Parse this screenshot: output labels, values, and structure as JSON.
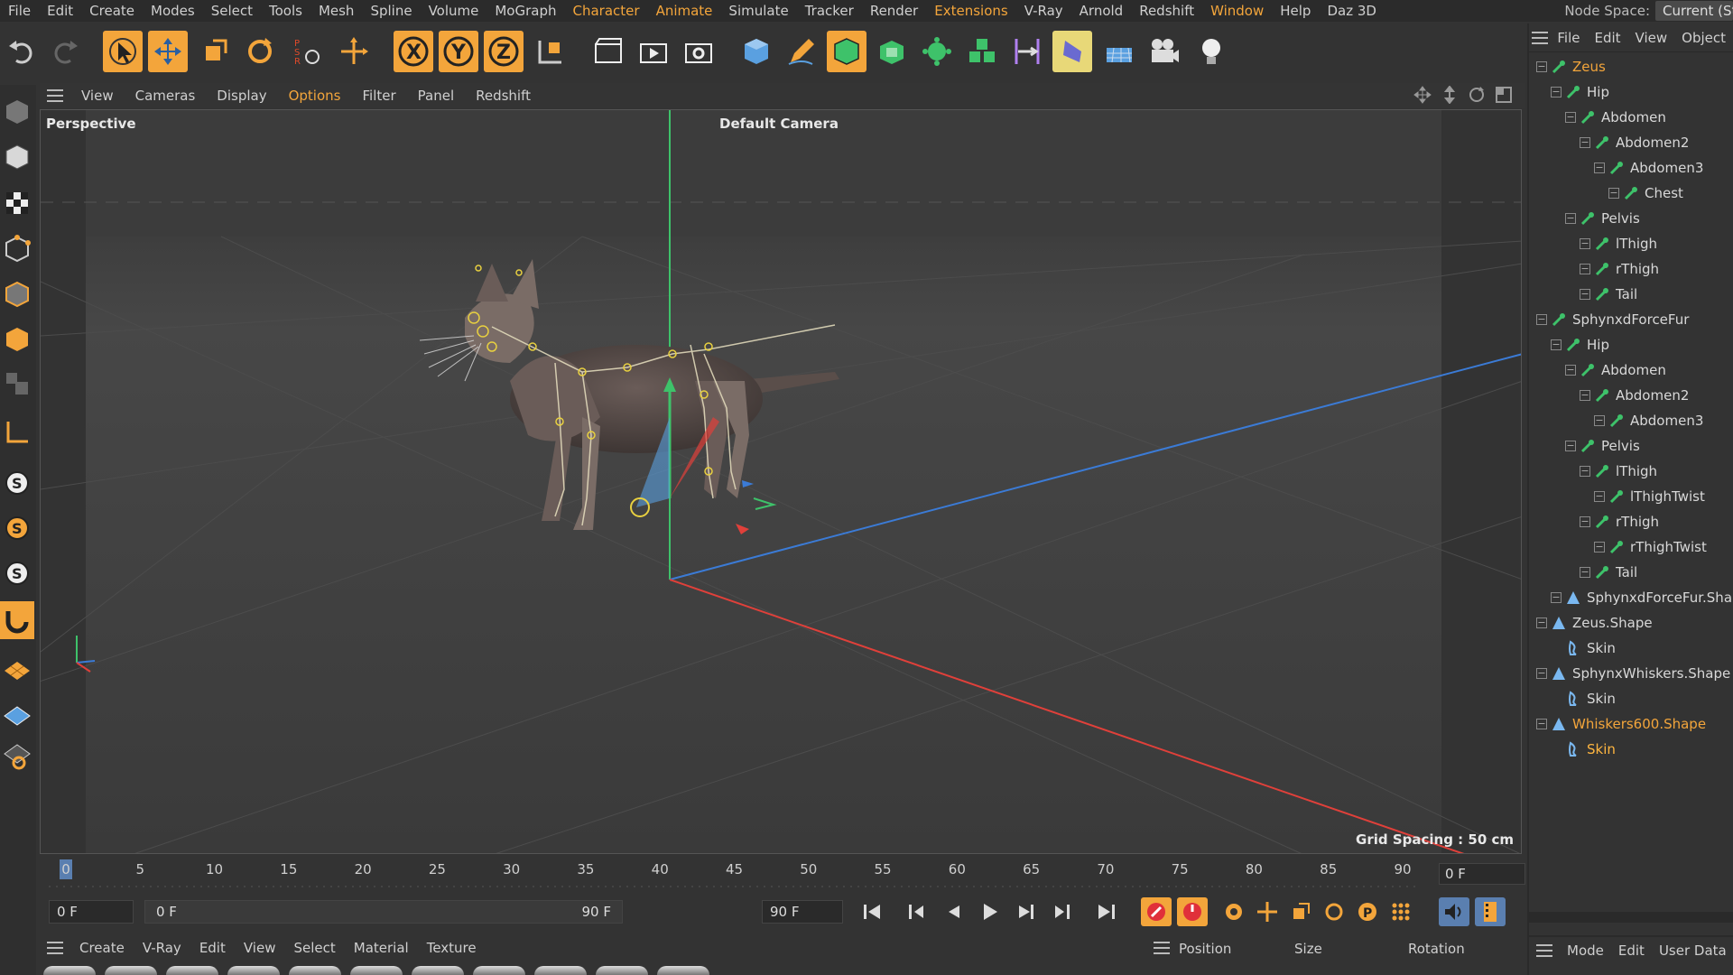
{
  "menubar": {
    "items": [
      "File",
      "Edit",
      "Create",
      "Modes",
      "Select",
      "Tools",
      "Mesh",
      "Spline",
      "Volume",
      "MoGraph",
      "Character",
      "Animate",
      "Simulate",
      "Tracker",
      "Render",
      "Extensions",
      "V-Ray",
      "Arnold",
      "Redshift",
      "Window",
      "Help",
      "Daz 3D"
    ],
    "accent_items": [
      "Character",
      "Animate",
      "Extensions",
      "Window"
    ],
    "node_space_label": "Node Space:",
    "node_space_value": "Current (St"
  },
  "viewport": {
    "menu": [
      "View",
      "Cameras",
      "Display",
      "Options",
      "Filter",
      "Panel",
      "Redshift"
    ],
    "accent_menu": "Options",
    "projection_label": "Perspective",
    "camera_label": "Default Camera",
    "grid_spacing": "Grid Spacing : 50 cm"
  },
  "timeline": {
    "ticks": [
      "0",
      "5",
      "10",
      "15",
      "20",
      "25",
      "30",
      "35",
      "40",
      "45",
      "50",
      "55",
      "60",
      "65",
      "70",
      "75",
      "80",
      "85",
      "90"
    ],
    "current_frame": "0 F",
    "start_field": "0 F",
    "range_start": "0 F",
    "range_end": "90 F",
    "end_field": "90 F"
  },
  "material_bar": {
    "menu": [
      "Create",
      "V-Ray",
      "Edit",
      "View",
      "Select",
      "Material",
      "Texture"
    ]
  },
  "coordinates": {
    "headers": [
      "Position",
      "Size",
      "Rotation"
    ]
  },
  "object_manager": {
    "menu": [
      "File",
      "Edit",
      "View",
      "Object"
    ],
    "objects": [
      {
        "name": "Zeus",
        "depth": 0,
        "type": "joint",
        "selected": true
      },
      {
        "name": "Hip",
        "depth": 1,
        "type": "joint"
      },
      {
        "name": "Abdomen",
        "depth": 2,
        "type": "joint"
      },
      {
        "name": "Abdomen2",
        "depth": 3,
        "type": "joint"
      },
      {
        "name": "Abdomen3",
        "depth": 4,
        "type": "joint"
      },
      {
        "name": "Chest",
        "depth": 5,
        "type": "joint"
      },
      {
        "name": "Pelvis",
        "depth": 2,
        "type": "joint"
      },
      {
        "name": "lThigh",
        "depth": 3,
        "type": "joint"
      },
      {
        "name": "rThigh",
        "depth": 3,
        "type": "joint"
      },
      {
        "name": "Tail",
        "depth": 3,
        "type": "joint"
      },
      {
        "name": "SphynxdForceFur",
        "depth": 0,
        "type": "joint"
      },
      {
        "name": "Hip",
        "depth": 1,
        "type": "joint"
      },
      {
        "name": "Abdomen",
        "depth": 2,
        "type": "joint"
      },
      {
        "name": "Abdomen2",
        "depth": 3,
        "type": "joint"
      },
      {
        "name": "Abdomen3",
        "depth": 4,
        "type": "joint"
      },
      {
        "name": "Pelvis",
        "depth": 2,
        "type": "joint"
      },
      {
        "name": "lThigh",
        "depth": 3,
        "type": "joint"
      },
      {
        "name": "lThighTwist",
        "depth": 4,
        "type": "joint"
      },
      {
        "name": "rThigh",
        "depth": 3,
        "type": "joint"
      },
      {
        "name": "rThighTwist",
        "depth": 4,
        "type": "joint"
      },
      {
        "name": "Tail",
        "depth": 3,
        "type": "joint"
      },
      {
        "name": "SphynxdForceFur.Shap",
        "depth": 1,
        "type": "shape"
      },
      {
        "name": "Zeus.Shape",
        "depth": 0,
        "type": "shape"
      },
      {
        "name": "Skin",
        "depth": 1,
        "type": "skin"
      },
      {
        "name": "SphynxWhiskers.Shape",
        "depth": 0,
        "type": "shape"
      },
      {
        "name": "Skin",
        "depth": 1,
        "type": "skin"
      },
      {
        "name": "Whiskers600.Shape",
        "depth": 0,
        "type": "shape",
        "selected": true
      },
      {
        "name": "Skin",
        "depth": 1,
        "type": "skin",
        "selected": true,
        "bright": true
      }
    ]
  },
  "attributes": {
    "menu": [
      "Mode",
      "Edit",
      "User Data"
    ]
  },
  "colors": {
    "accent": "#f3a53b",
    "joint_green": "#3ec26a",
    "axis_x": "#e0403a",
    "axis_y": "#3ec26a",
    "axis_z": "#3b7bd6"
  }
}
